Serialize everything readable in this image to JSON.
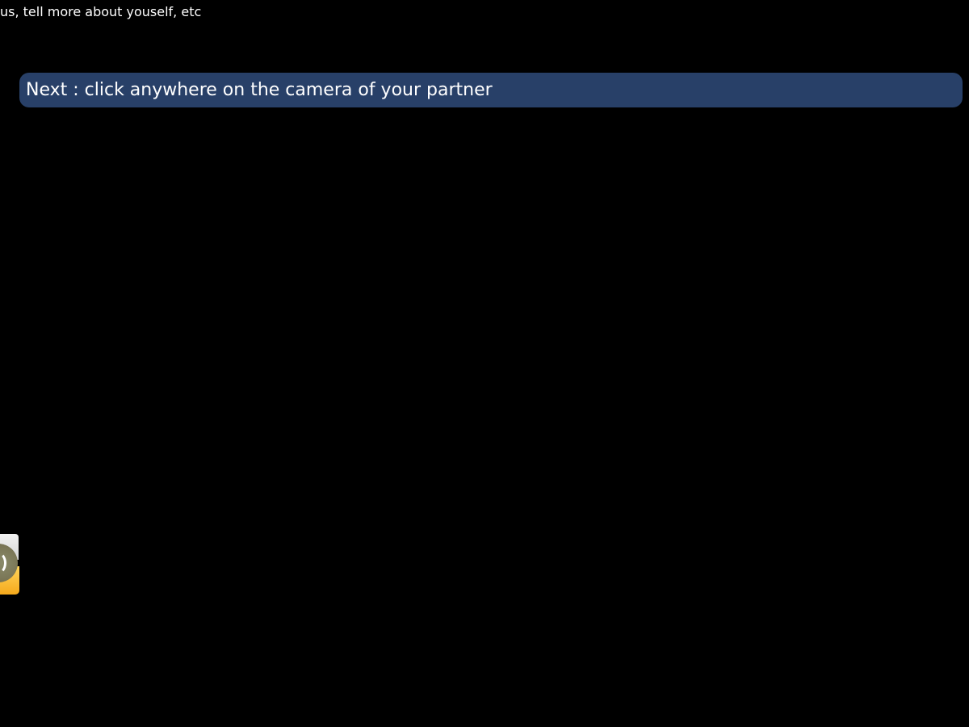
{
  "intro": {
    "text": "us, tell more about youself, etc"
  },
  "next_banner": {
    "label": "Next : click anywhere on the camera of your partner"
  },
  "side_widget": {
    "icon": "webcam-widget-icon"
  },
  "colors": {
    "background": "#000000",
    "banner": "#284068",
    "text": "#ffffff"
  }
}
